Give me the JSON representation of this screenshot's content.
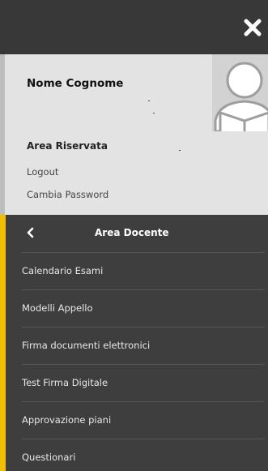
{
  "user": {
    "name": "Nome Cognome",
    "area_label": "Area Riservata",
    "logout_label": "Logout",
    "change_password_label": "Cambia Password"
  },
  "menu": {
    "title": "Area Docente",
    "items": [
      {
        "label": "Calendario Esami"
      },
      {
        "label": "Modelli Appello"
      },
      {
        "label": "Firma documenti elettronici"
      },
      {
        "label": "Test Firma Digitale"
      },
      {
        "label": "Approvazione piani"
      },
      {
        "label": "Questionari"
      }
    ]
  },
  "colors": {
    "accent": "#f2bf00",
    "dark_bg": "#3e3e3e",
    "panel_bg": "#e3e3e3"
  },
  "icons": {
    "close": "close-icon",
    "back": "chevron-left-icon",
    "avatar": "user-avatar-icon"
  }
}
